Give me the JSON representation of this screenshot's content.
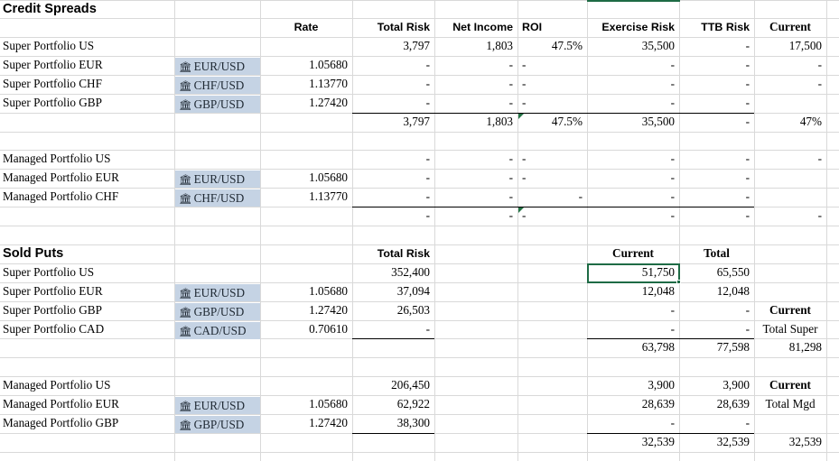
{
  "app": "spreadsheet",
  "colors": {
    "fx_cell_fill": "#c5d3e4",
    "selection_border": "#1e6b45",
    "gridline": "#d9d9d9",
    "total_rule": "#000000",
    "error_flag": "#247345"
  },
  "sections": [
    {
      "title": "Credit Spreads",
      "headers": {
        "rate": "Rate",
        "total_risk": "Total Risk",
        "net_income": "Net Income",
        "roi": "ROI",
        "exercise_risk": "Exercise Risk",
        "ttb_risk": "TTB Risk",
        "current": "Current"
      },
      "rows": [
        {
          "name": "Super Portfolio US",
          "pair": "",
          "rate": "",
          "total_risk": "3,797",
          "net_income": "1,803",
          "roi": "47.5%",
          "exercise_risk": "35,500",
          "ttb_risk": "-",
          "current": "17,500"
        },
        {
          "name": "Super Portfolio EUR",
          "pair": "EUR/USD",
          "rate": "1.05680",
          "total_risk": "-",
          "net_income": "-",
          "roi": "-",
          "exercise_risk": "-",
          "ttb_risk": "-",
          "current": "-"
        },
        {
          "name": "Super Portfolio CHF",
          "pair": "CHF/USD",
          "rate": "1.13770",
          "total_risk": "-",
          "net_income": "-",
          "roi": "-",
          "exercise_risk": "-",
          "ttb_risk": "-",
          "current": "-"
        },
        {
          "name": "Super Portfolio GBP",
          "pair": "GBP/USD",
          "rate": "1.27420",
          "total_risk": "-",
          "net_income": "-",
          "roi": "-",
          "exercise_risk": "-",
          "ttb_risk": "-",
          "current": ""
        }
      ],
      "total": {
        "total_risk": "3,797",
        "net_income": "1,803",
        "roi": "47.5%",
        "exercise_risk": "35,500",
        "ttb_risk": "-",
        "current": "47%"
      },
      "rows2": [
        {
          "name": "Managed Portfolio US",
          "pair": "",
          "rate": "",
          "total_risk": "-",
          "net_income": "-",
          "roi": "-",
          "exercise_risk": "-",
          "ttb_risk": "-",
          "current": "-"
        },
        {
          "name": "Managed Portfolio EUR",
          "pair": "EUR/USD",
          "rate": "1.05680",
          "total_risk": "-",
          "net_income": "-",
          "roi": "-",
          "exercise_risk": "-",
          "ttb_risk": "-",
          "current": ""
        },
        {
          "name": "Managed Portfolio CHF",
          "pair": "CHF/USD",
          "rate": "1.13770",
          "total_risk": "-",
          "net_income": "-",
          "roi": "-",
          "exercise_risk": "-",
          "ttb_risk": "-",
          "current": ""
        }
      ],
      "total2": {
        "total_risk": "-",
        "net_income": "-",
        "roi": "-",
        "exercise_risk": "-",
        "ttb_risk": "-",
        "current": "-"
      }
    },
    {
      "title": "Sold Puts",
      "headers": {
        "total_risk": "Total Risk",
        "current": "Current",
        "total": "Total"
      },
      "rows": [
        {
          "name": "Super Portfolio US",
          "pair": "",
          "rate": "",
          "total_risk": "352,400",
          "current": "51,750",
          "total": "65,550",
          "extra": ""
        },
        {
          "name": "Super Portfolio EUR",
          "pair": "EUR/USD",
          "rate": "1.05680",
          "total_risk": "37,094",
          "current": "12,048",
          "total": "12,048",
          "extra": ""
        },
        {
          "name": "Super Portfolio GBP",
          "pair": "GBP/USD",
          "rate": "1.27420",
          "total_risk": "26,503",
          "current": "-",
          "total": "-",
          "extra": "Current"
        },
        {
          "name": "Super Portfolio CAD",
          "pair": "CAD/USD",
          "rate": "0.70610",
          "total_risk": "-",
          "current": "-",
          "total": "-",
          "extra": "Total Super"
        }
      ],
      "total": {
        "current": "63,798",
        "total": "77,598",
        "extra": "81,298"
      },
      "rows2": [
        {
          "name": "Managed Portfolio US",
          "pair": "",
          "rate": "",
          "total_risk": "206,450",
          "current": "3,900",
          "total": "3,900",
          "extra": "Current"
        },
        {
          "name": "Managed Portfolio EUR",
          "pair": "EUR/USD",
          "rate": "1.05680",
          "total_risk": "62,922",
          "current": "28,639",
          "total": "28,639",
          "extra": "Total Mgd"
        },
        {
          "name": "Managed Portfolio GBP",
          "pair": "GBP/USD",
          "rate": "1.27420",
          "total_risk": "38,300",
          "current": "-",
          "total": "-",
          "extra": ""
        }
      ],
      "total2": {
        "current": "32,539",
        "total": "32,539",
        "extra": "32,539"
      }
    }
  ],
  "icons": {
    "bank": "🏛"
  },
  "selection": {
    "value": "51,750"
  }
}
